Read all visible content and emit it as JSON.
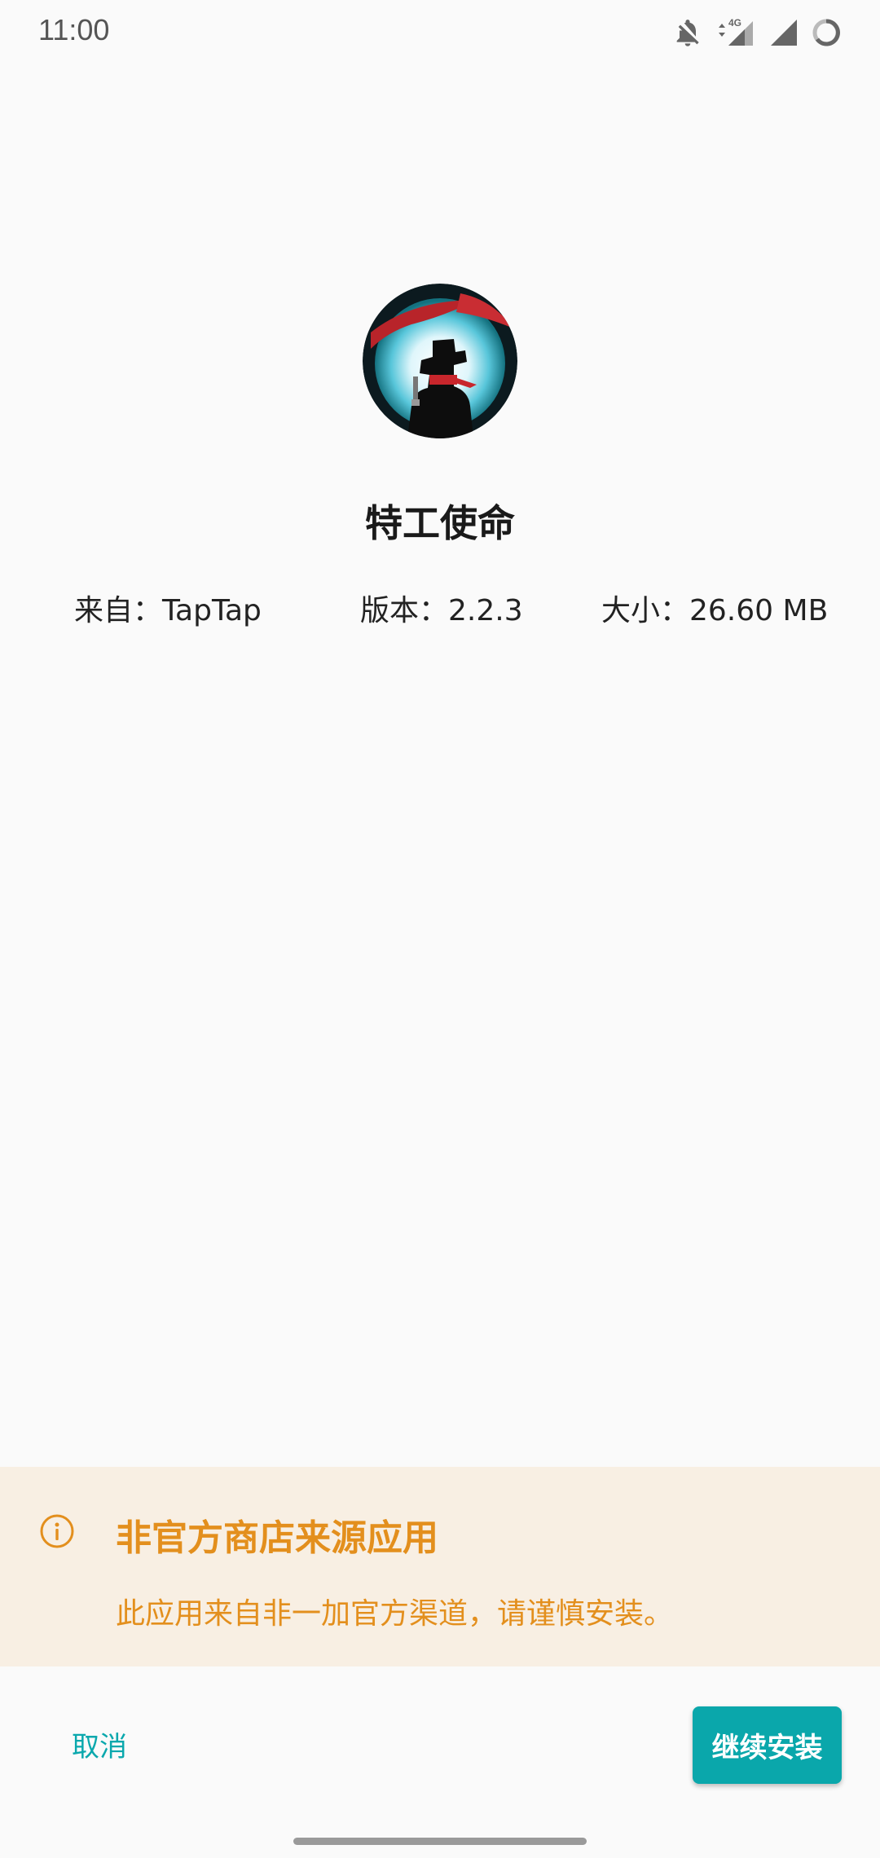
{
  "status_bar": {
    "time": "11:00",
    "network": "4G",
    "icons": [
      "bell-off-icon",
      "data-arrows-icon",
      "signal-4g-icon",
      "signal-icon",
      "battery-ring-icon"
    ]
  },
  "app": {
    "name": "特工使命",
    "icon": "ninja-game-icon",
    "source": "来自：TapTap",
    "version": "版本：2.2.3",
    "size": "大小：26.60 MB"
  },
  "warning": {
    "icon": "info-circle-icon",
    "title": "非官方商店来源应用",
    "message": "此应用来自非一加官方渠道，请谨慎安装。",
    "color": "#e38f1d",
    "background": "#f8efe3"
  },
  "actions": {
    "cancel_label": "取消",
    "install_label": "继续安装",
    "accent_color": "#0aa7ab"
  }
}
